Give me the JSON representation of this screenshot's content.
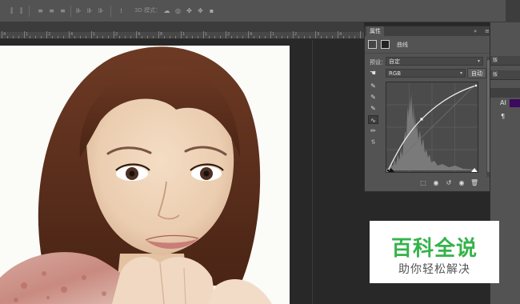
{
  "options_bar": {
    "mode3d_label": "3D 模式："
  },
  "ruler": {
    "numbers": [
      "4",
      "1",
      "2",
      "4",
      "1",
      "2",
      "4",
      "8",
      "1",
      "1",
      "2",
      "4",
      "1",
      "2",
      "3",
      "4"
    ]
  },
  "properties_panel": {
    "tab_label": "属性",
    "collapse_label": "»",
    "menu_label": "≡",
    "adjustment_label": "曲线",
    "preset_label": "预设：",
    "preset_value": "自定",
    "channel_value": "RGB",
    "auto_button": "自动"
  },
  "dock": {
    "headers": [
      "版",
      "版"
    ],
    "ai_label": "AI",
    "paragraph_label": "¶",
    "accent_swatch": "#3c0a5e"
  },
  "watermark": {
    "title": "百科全说",
    "subtitle": "助你轻松解决",
    "title_color": "#34b34a"
  },
  "icons": [
    "align-icon",
    "distribute-icon",
    "3d-mode-icon",
    "curves-adjustment-icon",
    "mask-icon",
    "hand-target-icon",
    "eyedropper-icon",
    "curve-edit-icon",
    "pencil-icon",
    "smooth-icon",
    "clip-icon",
    "visibility-icon",
    "reset-icon",
    "trash-icon"
  ]
}
